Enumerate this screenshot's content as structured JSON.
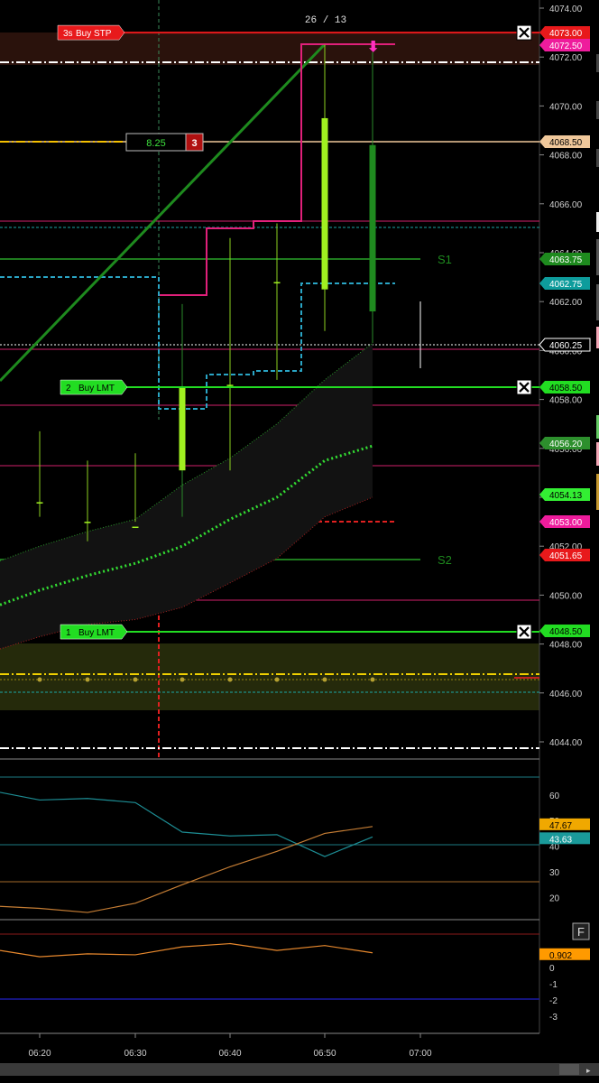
{
  "bar_counter": "26 / 13",
  "price_axis": {
    "ticks": [
      "4074.00",
      "4072.00",
      "4070.00",
      "4068.00",
      "4066.00",
      "4064.00",
      "4062.00",
      "4060.00",
      "4058.00",
      "4056.00",
      "4054.00",
      "4052.00",
      "4050.00",
      "4048.00",
      "4046.00",
      "4044.00"
    ]
  },
  "price_tags": [
    {
      "id": "buy-stp",
      "text": "4073.00",
      "price": 4073.0,
      "bg": "#e8191b",
      "fg": "#ffffff"
    },
    {
      "id": "high",
      "text": "4072.50",
      "price": 4072.5,
      "bg": "#ee1c9c",
      "fg": "#ffffff"
    },
    {
      "id": "position",
      "text": "4068.50",
      "price": 4068.5,
      "bg": "#f0c89b",
      "fg": "#000000"
    },
    {
      "id": "s1",
      "text": "4063.75",
      "price": 4063.75,
      "bg": "#1e8a1e",
      "fg": "#ffffff"
    },
    {
      "id": "teal",
      "text": "4062.75",
      "price": 4062.75,
      "bg": "#0e9c9c",
      "fg": "#ffffff"
    },
    {
      "id": "last",
      "text": "4060.25",
      "price": 4060.25,
      "bg": "#000000",
      "fg": "#ffffff",
      "border": "#ffffff"
    },
    {
      "id": "buy-lmt-2",
      "text": "4058.50",
      "price": 4058.5,
      "bg": "#22dd22",
      "fg": "#000000"
    },
    {
      "id": "upper-band",
      "text": "4056.20",
      "price": 4056.2,
      "bg": "#2d8f2d",
      "fg": "#ffffff"
    },
    {
      "id": "mid-band",
      "text": "4054.13",
      "price": 4054.13,
      "bg": "#33ee33",
      "fg": "#000000"
    },
    {
      "id": "stop-red",
      "text": "4053.00",
      "price": 4053.0,
      "bg": "#ee1c9c",
      "fg": "#ffffff"
    },
    {
      "id": "lower-band",
      "text": "4051.65",
      "price": 4051.65,
      "bg": "#e8191b",
      "fg": "#ffffff"
    },
    {
      "id": "buy-lmt-1",
      "text": "4048.50",
      "price": 4048.5,
      "bg": "#22dd22",
      "fg": "#000000"
    }
  ],
  "orders": [
    {
      "id": "order-buy-stp",
      "qty": "3s",
      "label": "Buy STP",
      "price": 4073.0,
      "color": "#e8191b",
      "text_color": "#ffffff"
    },
    {
      "id": "order-buy-lmt-2",
      "qty": "2",
      "label": "Buy LMT",
      "price": 4058.5,
      "color": "#22dd22",
      "text_color": "#000000"
    },
    {
      "id": "order-buy-lmt-1",
      "qty": "1",
      "label": "Buy LMT",
      "price": 4048.5,
      "color": "#22dd22",
      "text_color": "#000000"
    }
  ],
  "position_box": {
    "pnl": "8.25",
    "qty": "3"
  },
  "pivots": [
    {
      "label": "S1",
      "price": 4063.75
    },
    {
      "label": "S2",
      "price": 4051.65
    }
  ],
  "time_axis": {
    "ticks": [
      "06:20",
      "06:30",
      "06:40",
      "06:50",
      "07:00"
    ]
  },
  "chart_data": [
    {
      "type": "candlestick",
      "title": "",
      "x": [
        "06:20",
        "06:25",
        "06:30",
        "06:35",
        "06:40",
        "06:45",
        "06:50",
        "06:55"
      ],
      "open": [
        4053.8,
        4053.0,
        4052.8,
        4058.5,
        4058.6,
        4062.8,
        4062.5,
        4068.4
      ],
      "high": [
        4056.7,
        4055.5,
        4055.8,
        4061.9,
        4064.6,
        4065.2,
        4072.5,
        4072.2
      ],
      "low": [
        4053.2,
        4052.2,
        4053.0,
        4053.2,
        4055.1,
        4058.8,
        4060.8,
        4060.3
      ],
      "close": [
        4053.8,
        4053.0,
        4052.8,
        4055.1,
        4058.6,
        4062.8,
        4069.5,
        4061.6
      ],
      "ylim": [
        4043.0,
        4074.5
      ],
      "bollinger_mid": [
        4050.2,
        4050.8,
        4051.3,
        4052.0,
        4053.1,
        4054.0,
        4055.5,
        4056.1
      ],
      "bollinger_upper": [
        4052.0,
        4052.6,
        4053.1,
        4054.5,
        4055.6,
        4057.0,
        4058.8,
        4060.3
      ],
      "bollinger_lower": [
        4048.3,
        4048.8,
        4049.0,
        4049.5,
        4050.5,
        4051.5,
        4053.2,
        4054.0
      ]
    },
    {
      "type": "line",
      "title": "",
      "x": [
        "06:20",
        "06:25",
        "06:30",
        "06:35",
        "06:40",
        "06:45",
        "06:50",
        "06:55"
      ],
      "ylim": [
        10,
        68
      ],
      "ticks": [
        "60",
        "50",
        "40",
        "30",
        "20"
      ],
      "series": [
        {
          "color": "#1d8d94",
          "values": [
            58,
            58.6,
            57,
            45.5,
            44,
            44.5,
            36,
            43.63
          ]
        },
        {
          "color": "#c57d34",
          "values": [
            15.8,
            14.2,
            17.8,
            25,
            32,
            38,
            45,
            47.67
          ]
        }
      ],
      "tags": [
        {
          "text": "47.67",
          "value": 47.67,
          "bg": "#f0a800",
          "fg": "#000000"
        },
        {
          "text": "43.63",
          "value": 43.63,
          "bg": "#1a9a9a",
          "fg": "#ffffff"
        }
      ]
    },
    {
      "type": "line",
      "title": "",
      "x": [
        "06:20",
        "06:25",
        "06:30",
        "06:35",
        "06:40",
        "06:45",
        "06:50",
        "06:55"
      ],
      "ylim": [
        -3.8,
        1.7
      ],
      "ticks": [
        "0",
        "-1",
        "-2",
        "-3"
      ],
      "series": [
        {
          "color": "#e7882d",
          "values": [
            0.66,
            0.84,
            0.78,
            1.27,
            1.47,
            1.05,
            1.35,
            0.902
          ]
        }
      ],
      "tags": [
        {
          "text": "0.902",
          "value": 0.902,
          "bg": "#ff9a00",
          "fg": "#000000"
        }
      ]
    }
  ],
  "toolbar": {
    "f_button": "F"
  },
  "colors": {
    "background": "#000000",
    "grid": "#1a1a1a",
    "axis_text": "#d0d0d0"
  }
}
